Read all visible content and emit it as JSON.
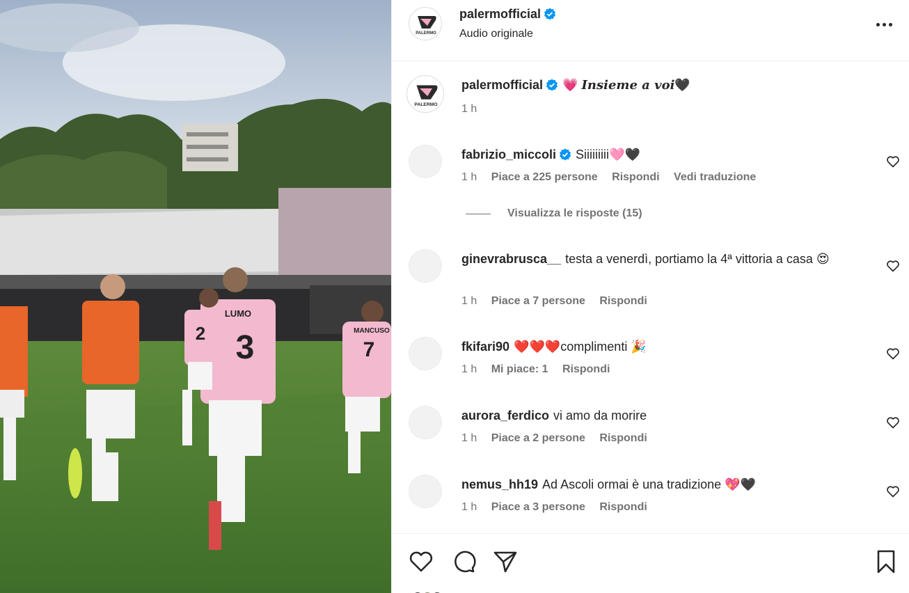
{
  "post": {
    "username": "palermofficial",
    "audio": "Audio originale",
    "verified": true,
    "avatar_text": "PALERMO",
    "caption": "Insieme a voi",
    "caption_time": "1 h"
  },
  "comments": [
    {
      "username": "fabrizio_miccoli",
      "verified": true,
      "text": "Siiiiiiiii🩷🖤",
      "time": "1 h",
      "likes": "Piace a 225 persone",
      "reply": "Rispondi",
      "translate": "Vedi traduzione",
      "view_replies": "Visualizza le risposte (15)"
    },
    {
      "username": "ginevrabrusca__",
      "verified": false,
      "text": "testa a venerdì, portiamo la 4ª vittoria a casa 😍",
      "time": "1 h",
      "likes": "Piace a 7 persone",
      "reply": "Rispondi"
    },
    {
      "username": "fkifari90",
      "verified": false,
      "text": "❤️❤️❤️complimenti 🎉",
      "time": "1 h",
      "likes": "Mi piace: 1",
      "reply": "Rispondi"
    },
    {
      "username": "aurora_ferdico",
      "verified": false,
      "text": "vi amo da morire",
      "time": "1 h",
      "likes": "Piace a 2 persone",
      "reply": "Rispondi"
    },
    {
      "username": "nemus_hh19",
      "verified": false,
      "text": "Ad Ascoli ormai è una tradizione 💖🖤",
      "time": "1 h",
      "likes": "Piace a 3 persone",
      "reply": "Rispondi"
    }
  ],
  "icons": {
    "like": "heart-icon",
    "comment": "comment-icon",
    "share": "share-icon",
    "save": "bookmark-icon",
    "more": "more-icon",
    "verified": "verified-badge-icon"
  },
  "colors": {
    "verified": "#0095f6",
    "text": "#262626",
    "secondary": "#737373",
    "border": "#efefef"
  },
  "media": {
    "jersey_names": [
      "LUMO",
      "MANCUSO"
    ],
    "jersey_numbers": [
      "3",
      "7",
      "2"
    ]
  }
}
